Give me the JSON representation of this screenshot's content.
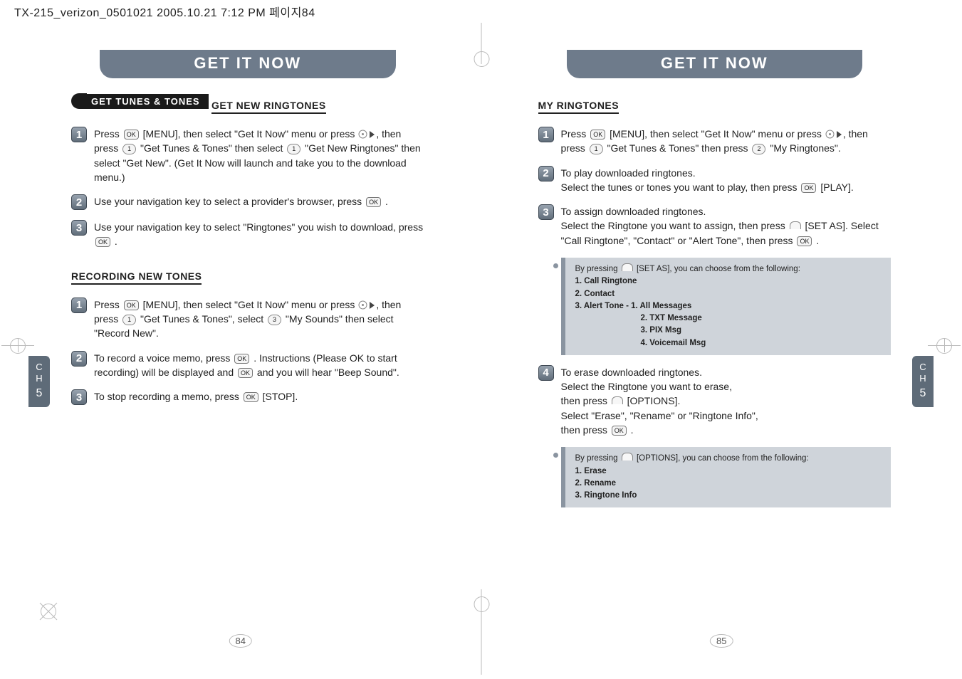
{
  "scan_header": "TX-215_verizon_0501021  2005.10.21  7:12 PM  페이지84",
  "left": {
    "banner": "GET IT NOW",
    "ribbon": "GET TUNES & TONES",
    "section1_title": "GET NEW RINGTONES",
    "s1_step1": "Press  OK  [MENU], then select \"Get It Now\" menu or press  ▶ , then press  1  \"Get Tunes & Tones\" then select  1  \"Get New Ringtones\" then select \"Get New\". (Get It Now will launch and take you to the download menu.)",
    "s1_step2": "Use your navigation key to select a provider's browser, press  OK  .",
    "s1_step3": "Use your navigation key to select \"Ringtones\" you wish to download, press  OK  .",
    "section2_title": "RECORDING NEW TONES",
    "s2_step1": "Press  OK  [MENU], then select \"Get It Now\" menu or press  ▶ , then press  1  \"Get Tunes & Tones\", select  3  \"My Sounds\" then select \"Record New\".",
    "s2_step2": "To record a voice memo, press  OK  . Instructions (Please OK to start recording) will be displayed and  OK  and you will hear \"Beep Sound\".",
    "s2_step3": "To stop recording a memo, press  OK  [STOP].",
    "ch_label": "C\nH",
    "ch_num": "5",
    "pagenum": "84"
  },
  "right": {
    "banner": "GET IT NOW",
    "section_title": "MY RINGTONES",
    "step1": "Press  OK  [MENU], then select \"Get It Now\" menu or press  ▶ , then press  1  \"Get Tunes & Tones\" then press  2  \"My Ringtones\".",
    "step2": "To play downloaded ringtones. Select the tunes or tones you want to play, then press  OK  [PLAY].",
    "step3": "To assign downloaded ringtones. Select the Ringtone you want to assign, then press  ⌂  [SET AS]. Select \"Call Ringtone\", \"Contact\" or \"Alert Tone\", then press  OK  .",
    "box1_intro": "By pressing  ⌂  [SET AS], you can choose from the following:",
    "box1_l1": "1. Call Ringtone",
    "box1_l2": "2. Contact",
    "box1_l3": "3. Alert Tone -  1. All Messages",
    "box1_l3b": "2. TXT Message",
    "box1_l3c": "3. PIX Msg",
    "box1_l3d": "4. Voicemail Msg",
    "step4": "To erase downloaded ringtones. Select the Ringtone you want to erase, then press  ⌂  [OPTIONS]. Select \"Erase\", \"Rename\" or \"Ringtone Info\", then press  OK  .",
    "box2_intro": "By pressing  ⌂  [OPTIONS], you can choose from the following:",
    "box2_l1": "1. Erase",
    "box2_l2": "2. Rename",
    "box2_l3": "3. Ringtone Info",
    "ch_label": "C\nH",
    "ch_num": "5",
    "pagenum": "85"
  }
}
